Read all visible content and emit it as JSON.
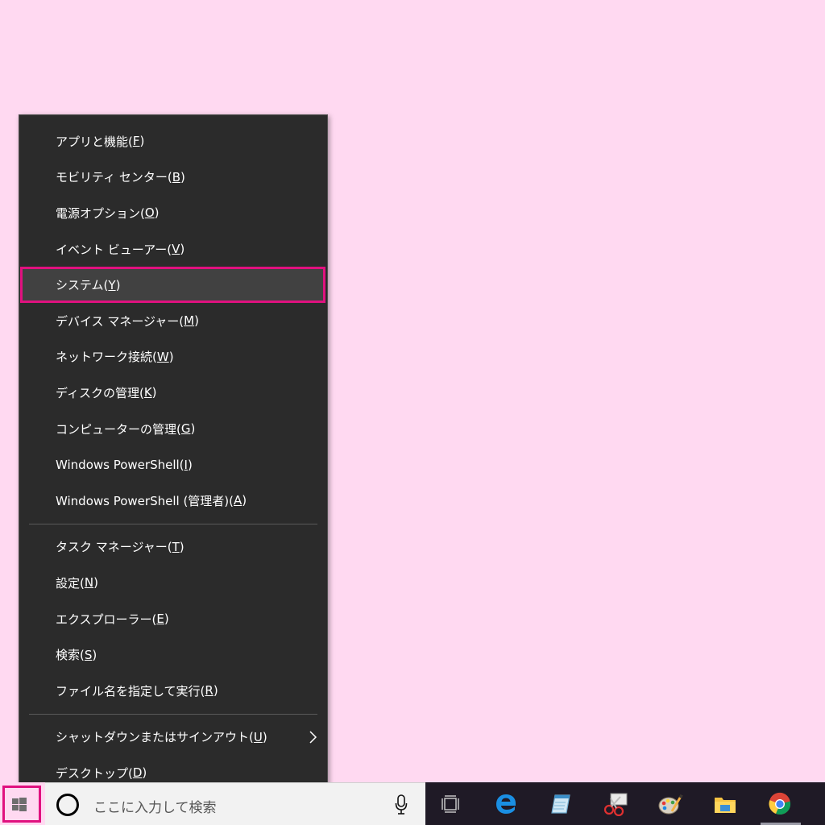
{
  "menu": {
    "items": [
      {
        "label": "アプリと機能(",
        "key": "F",
        "suffix": ")"
      },
      {
        "label": "モビリティ センター(",
        "key": "B",
        "suffix": ")"
      },
      {
        "label": "電源オプション(",
        "key": "O",
        "suffix": ")"
      },
      {
        "label": "イベント ビューアー(",
        "key": "V",
        "suffix": ")"
      },
      {
        "label": "システム(",
        "key": "Y",
        "suffix": ")"
      },
      {
        "label": "デバイス マネージャー(",
        "key": "M",
        "suffix": ")"
      },
      {
        "label": "ネットワーク接続(",
        "key": "W",
        "suffix": ")"
      },
      {
        "label": "ディスクの管理(",
        "key": "K",
        "suffix": ")"
      },
      {
        "label": "コンピューターの管理(",
        "key": "G",
        "suffix": ")"
      },
      {
        "label": "Windows PowerShell(",
        "key": "I",
        "suffix": ")"
      },
      {
        "label": "Windows PowerShell (管理者)(",
        "key": "A",
        "suffix": ")"
      },
      {
        "label": "タスク マネージャー(",
        "key": "T",
        "suffix": ")"
      },
      {
        "label": "設定(",
        "key": "N",
        "suffix": ")"
      },
      {
        "label": "エクスプローラー(",
        "key": "E",
        "suffix": ")"
      },
      {
        "label": "検索(",
        "key": "S",
        "suffix": ")"
      },
      {
        "label": "ファイル名を指定して実行(",
        "key": "R",
        "suffix": ")"
      },
      {
        "label": "シャットダウンまたはサインアウト(",
        "key": "U",
        "suffix": ")"
      },
      {
        "label": "デスクトップ(",
        "key": "D",
        "suffix": ")"
      }
    ]
  },
  "taskbar": {
    "search_placeholder": "ここに入力して検索"
  },
  "colors": {
    "desktop": "#ffd9f1",
    "menu_bg": "#2b2b2b",
    "highlight_border": "#e0117f",
    "taskbar": "#1f1a26"
  }
}
